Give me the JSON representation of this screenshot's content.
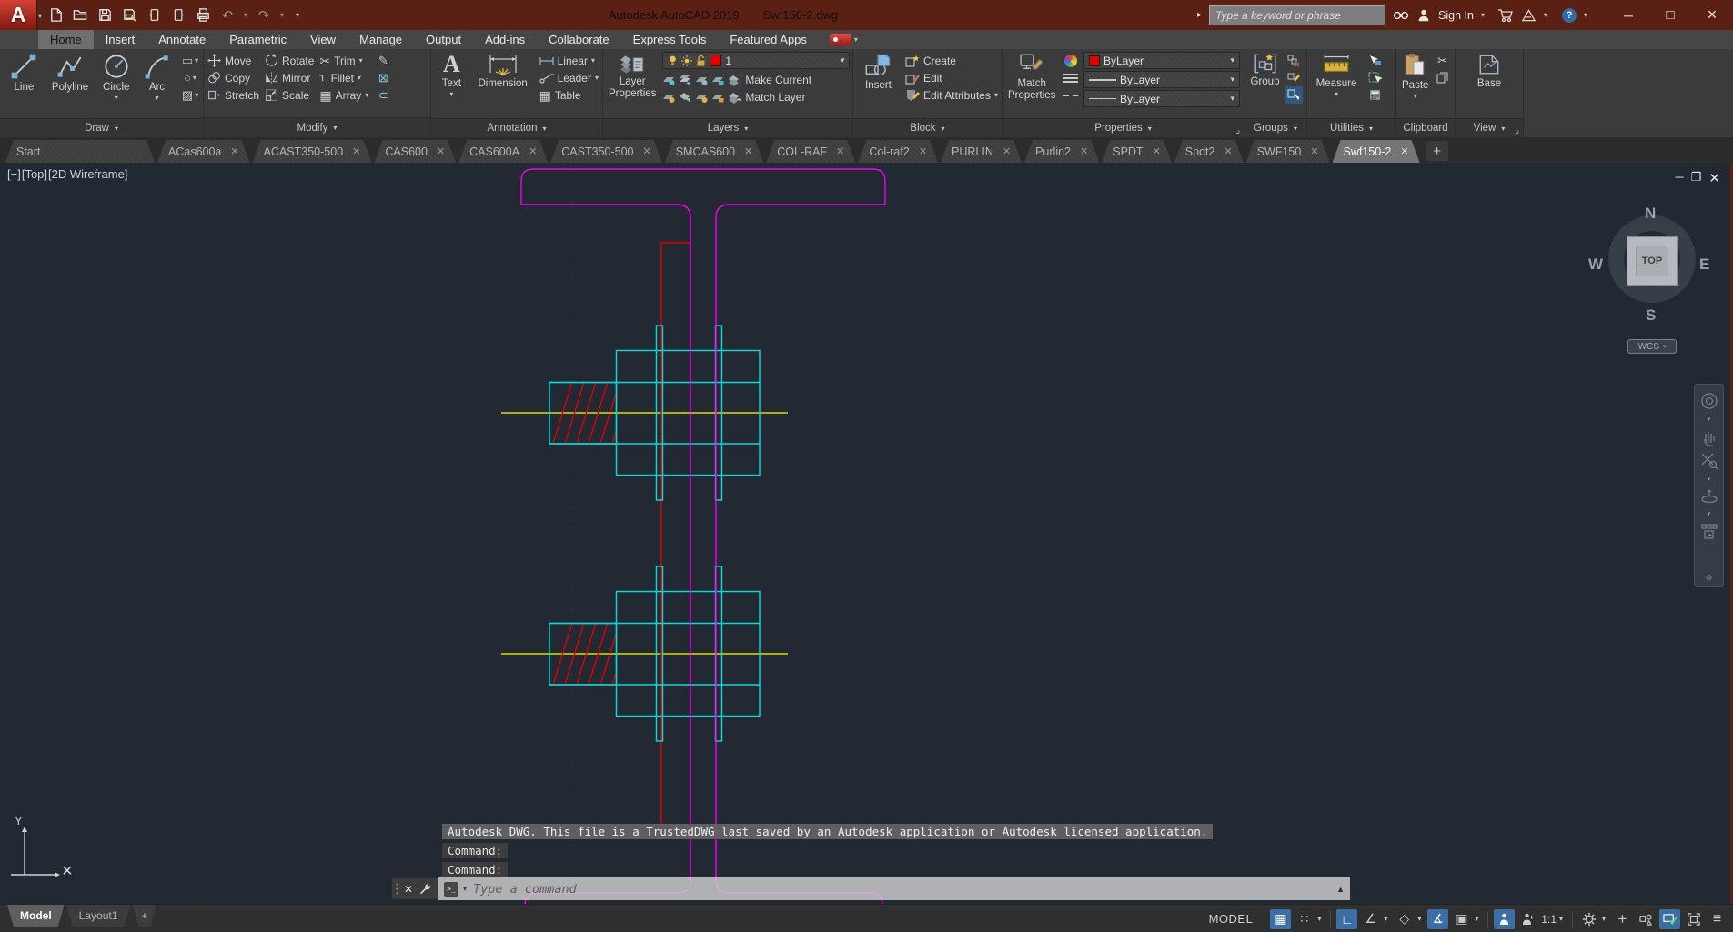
{
  "titlebar": {
    "app_title": "Autodesk AutoCAD 2019",
    "doc_title": "Swf150-2.dwg",
    "search_placeholder": "Type a keyword or phrase",
    "sign_in": "Sign In",
    "help_glyph": "?"
  },
  "ribbon_tabs": [
    {
      "label": "Home"
    },
    {
      "label": "Insert"
    },
    {
      "label": "Annotate"
    },
    {
      "label": "Parametric"
    },
    {
      "label": "View"
    },
    {
      "label": "Manage"
    },
    {
      "label": "Output"
    },
    {
      "label": "Add-ins"
    },
    {
      "label": "Collaborate"
    },
    {
      "label": "Express Tools"
    },
    {
      "label": "Featured Apps"
    }
  ],
  "panels": {
    "draw": {
      "label": "Draw",
      "line": "Line",
      "polyline": "Polyline",
      "circle": "Circle",
      "arc": "Arc"
    },
    "modify": {
      "label": "Modify",
      "move": "Move",
      "copy": "Copy",
      "stretch": "Stretch",
      "rotate": "Rotate",
      "mirror": "Mirror",
      "scale": "Scale",
      "trim": "Trim",
      "fillet": "Fillet",
      "array": "Array"
    },
    "annotation": {
      "label": "Annotation",
      "text": "Text",
      "dimension": "Dimension",
      "linear": "Linear",
      "leader": "Leader",
      "table": "Table"
    },
    "layers": {
      "label": "Layers",
      "layer_properties": "Layer\nProperties",
      "current_layer": "1",
      "make_current": "Make Current",
      "match_layer": "Match Layer"
    },
    "block": {
      "label": "Block",
      "insert": "Insert",
      "create": "Create",
      "edit": "Edit",
      "edit_attributes": "Edit Attributes"
    },
    "properties": {
      "label": "Properties",
      "match_properties": "Match\nProperties",
      "color_value": "ByLayer",
      "lineweight_value": "ByLayer",
      "linetype_value": "ByLayer"
    },
    "groups": {
      "label": "Groups",
      "group": "Group"
    },
    "utilities": {
      "label": "Utilities",
      "measure": "Measure"
    },
    "clipboard": {
      "label": "Clipboard",
      "paste": "Paste"
    },
    "view": {
      "label": "View",
      "base": "Base"
    }
  },
  "file_tabs": [
    {
      "label": "Start"
    },
    {
      "label": "ACas600a"
    },
    {
      "label": "ACAST350-500"
    },
    {
      "label": "CAS600"
    },
    {
      "label": "CAS600A"
    },
    {
      "label": "CAST350-500"
    },
    {
      "label": "SMCAS600"
    },
    {
      "label": "COL-RAF"
    },
    {
      "label": "Col-raf2"
    },
    {
      "label": "PURLIN"
    },
    {
      "label": "Purlin2"
    },
    {
      "label": "SPDT"
    },
    {
      "label": "Spdt2"
    },
    {
      "label": "SWF150"
    },
    {
      "label": "Swf150-2"
    }
  ],
  "viewport": {
    "controls": {
      "minimize": "[−]",
      "view": "[Top]",
      "visual_style": "[2D Wireframe]"
    },
    "viewcube": {
      "n": "N",
      "s": "S",
      "e": "E",
      "w": "W",
      "face": "TOP",
      "wcs": "WCS"
    },
    "ucs_y": "Y"
  },
  "command": {
    "trusted": "Autodesk DWG.  This file is a TrustedDWG last saved by an Autodesk application or Autodesk licensed application.",
    "line1": "Command:",
    "line2": "Command:",
    "placeholder": "Type a command"
  },
  "status": {
    "model_tab": "Model",
    "layout_tab": "Layout1",
    "mode": "MODEL",
    "annotation_scale": "1:1"
  },
  "colors": {
    "titlebar": "#5a2013",
    "canvas_background": "#222933",
    "geometry_magenta": "#f400f4",
    "geometry_cyan": "#00dede",
    "geometry_red": "#e00000",
    "geometry_yellow": "#dede00",
    "active_toggle_blue": "#3c70a4",
    "layer_swatch_red": "#e00000"
  }
}
